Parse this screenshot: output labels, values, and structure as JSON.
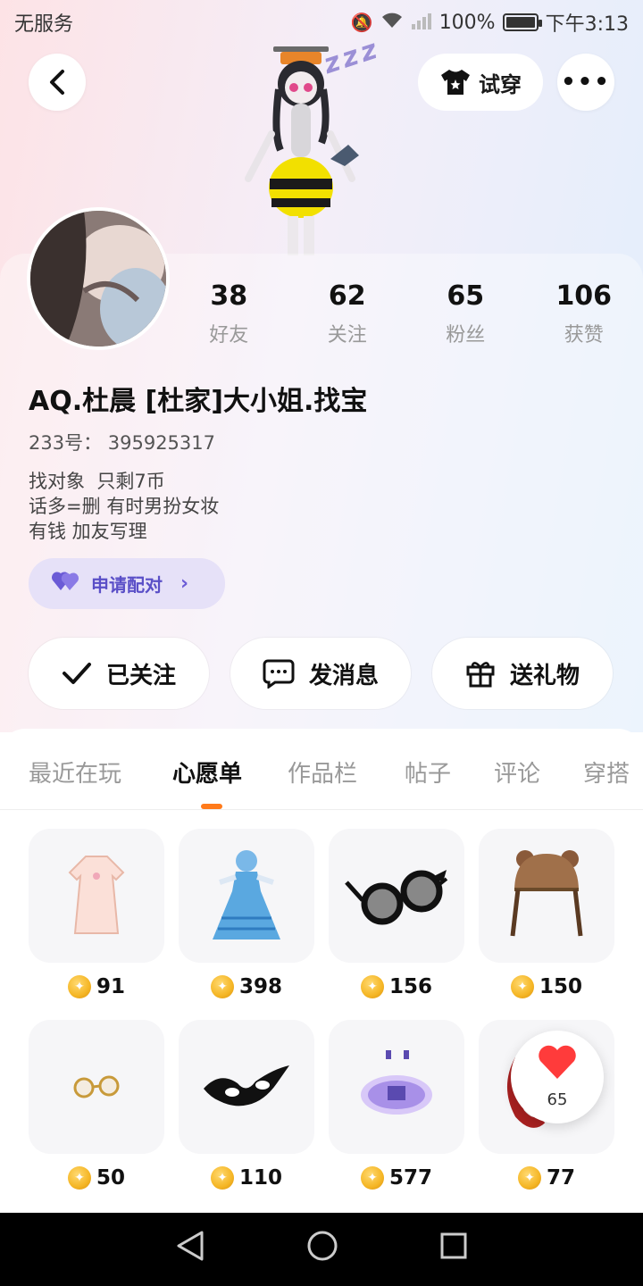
{
  "status_bar": {
    "carrier": "无服务",
    "battery": "100%",
    "time": "下午3:13"
  },
  "header": {
    "tryon_label": "试穿"
  },
  "stats": [
    {
      "value": "38",
      "label": "好友"
    },
    {
      "value": "62",
      "label": "关注"
    },
    {
      "value": "65",
      "label": "粉丝"
    },
    {
      "value": "106",
      "label": "获赞"
    }
  ],
  "profile": {
    "name": "AQ.杜晨 [杜家]大小姐.找宝",
    "uid": "233号： 395925317",
    "bio": [
      "找对象  只剩7币",
      "话多=删 有时男扮女妆",
      "有钱 加友写理"
    ]
  },
  "match": {
    "label": "申请配对"
  },
  "actions": {
    "follow": "已关注",
    "message": "发消息",
    "gift": "送礼物"
  },
  "tabs": [
    "最近在玩",
    "心愿单",
    "作品栏",
    "帖子",
    "评论",
    "穿搭"
  ],
  "active_tab": "心愿单",
  "wishlist": [
    {
      "price": "91",
      "icon": "pink-dress-icon"
    },
    {
      "price": "398",
      "icon": "blue-gown-icon"
    },
    {
      "price": "156",
      "icon": "cat-glasses-icon"
    },
    {
      "price": "150",
      "icon": "bear-hat-icon"
    },
    {
      "price": "50",
      "icon": "gold-glasses-icon"
    },
    {
      "price": "110",
      "icon": "black-mask-icon"
    },
    {
      "price": "577",
      "icon": "purple-platform-icon"
    },
    {
      "price": "77",
      "icon": "red-item-icon"
    }
  ],
  "like_float": {
    "count": "65"
  },
  "colors": {
    "accent_orange": "#ff7a1a",
    "match_purple": "#5a4fc7",
    "coin_gold": "#f5b625"
  }
}
